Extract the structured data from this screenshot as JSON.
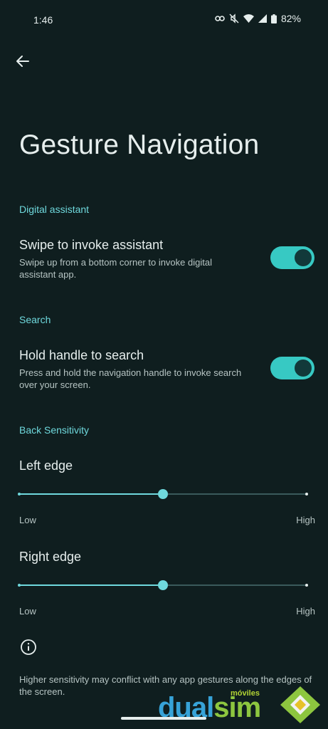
{
  "status_bar": {
    "time": "1:46",
    "battery": "82%",
    "icons": [
      "vpn-key-icon",
      "mute-icon",
      "wifi-icon",
      "signal-icon",
      "battery-icon"
    ]
  },
  "header": {
    "back_icon": "arrow-back-icon",
    "title": "Gesture Navigation"
  },
  "sections": {
    "digital_assistant": {
      "header": "Digital assistant",
      "item": {
        "title": "Swipe to invoke assistant",
        "summary": "Swipe up from a bottom corner to invoke digital assistant app.",
        "enabled": true
      }
    },
    "search": {
      "header": "Search",
      "item": {
        "title": "Hold handle to search",
        "summary": "Press and hold the navigation handle to invoke search over your screen.",
        "enabled": true
      }
    },
    "back_sensitivity": {
      "header": "Back Sensitivity",
      "left_edge": {
        "title": "Left edge",
        "low_label": "Low",
        "high_label": "High",
        "value": 0.5
      },
      "right_edge": {
        "title": "Right edge",
        "low_label": "Low",
        "high_label": "High",
        "value": 0.5
      }
    }
  },
  "footer": {
    "info_icon": "info-icon",
    "text": "Higher sensitivity may conflict with any app gestures along the edges of the screen."
  },
  "watermark": {
    "small": "móviles",
    "big_prefix": "dual",
    "big_suffix": "sim"
  },
  "colors": {
    "background": "#0f1e1f",
    "accent": "#6fd9dd",
    "toggle_on": "#37c9c3"
  }
}
